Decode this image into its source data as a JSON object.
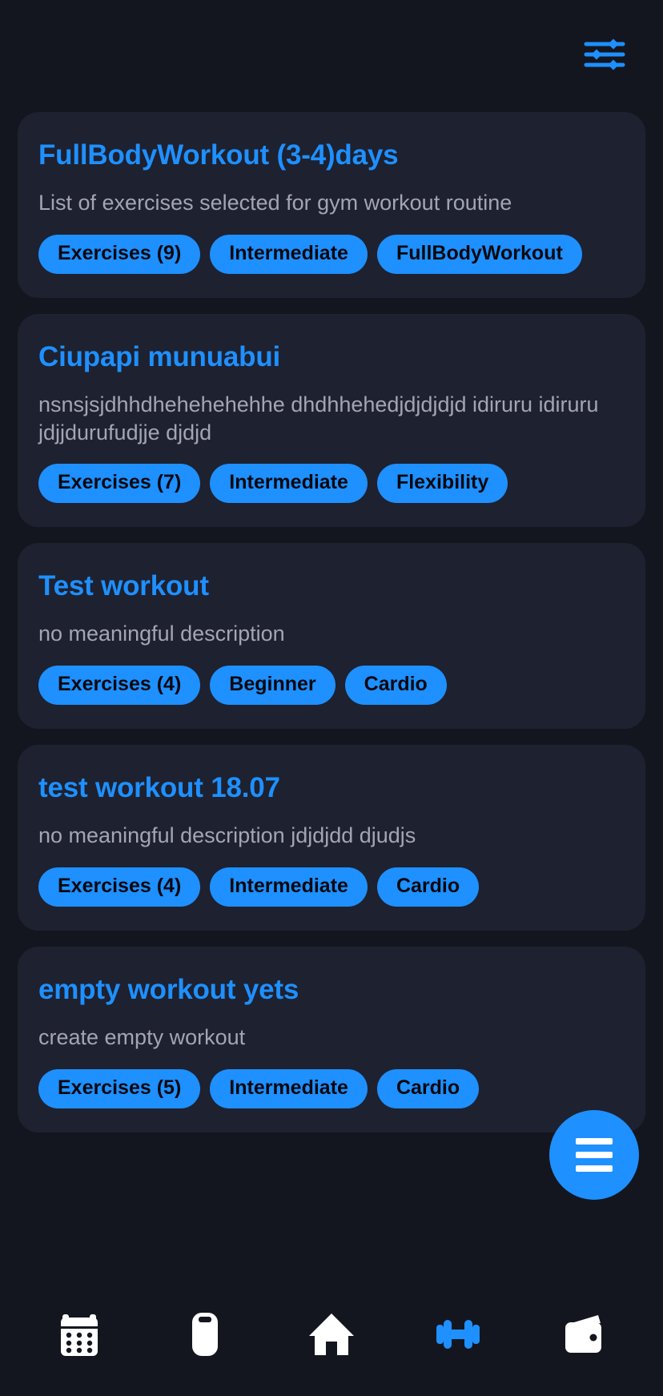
{
  "app": {
    "background_color": "#14161f",
    "card_color": "#1e2130",
    "accent_color": "#1e90ff",
    "muted_text_color": "#a3a5b3"
  },
  "topbar": {
    "filter_icon": "filter-sliders-icon"
  },
  "workouts": [
    {
      "title": "FullBodyWorkout (3-4)days",
      "description": "List of exercises selected for gym workout routine",
      "chips": [
        "Exercises (9)",
        "Intermediate",
        "FullBodyWorkout"
      ]
    },
    {
      "title": "Ciupapi munuabui",
      "description": "nsnsjsjdhhdhehehehehhe dhdhhehedjdjdjdjd idiruru idiruru jdjjdurufudjje djdjd",
      "chips": [
        "Exercises (7)",
        "Intermediate",
        "Flexibility"
      ]
    },
    {
      "title": "Test workout",
      "description": "no meaningful description",
      "chips": [
        "Exercises (4)",
        "Beginner",
        "Cardio"
      ]
    },
    {
      "title": "test workout 18.07",
      "description": "no meaningful description jdjdjdd djudjs",
      "chips": [
        "Exercises (4)",
        "Intermediate",
        "Cardio"
      ]
    },
    {
      "title": "empty workout yets",
      "description": "create empty workout",
      "chips": [
        "Exercises (5)",
        "Intermediate",
        "Cardio"
      ]
    }
  ],
  "fab": {
    "icon": "hamburger-menu-icon"
  },
  "bottomnav": {
    "items": [
      {
        "icon": "calendar-icon",
        "active": false
      },
      {
        "icon": "water-bottle-icon",
        "active": false
      },
      {
        "icon": "home-icon",
        "active": false
      },
      {
        "icon": "dumbbell-icon",
        "active": true
      },
      {
        "icon": "wallet-icon",
        "active": false
      }
    ]
  }
}
